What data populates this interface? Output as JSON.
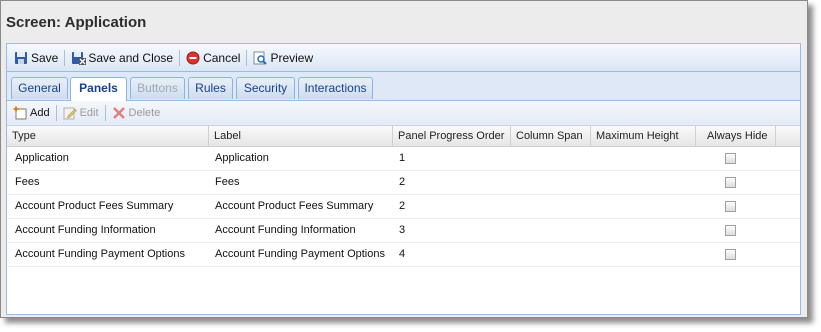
{
  "screen_title": "Screen: Application",
  "toolbar": {
    "save": "Save",
    "save_close": "Save and Close",
    "cancel": "Cancel",
    "preview": "Preview"
  },
  "tabs": [
    "General",
    "Panels",
    "Buttons",
    "Rules",
    "Security",
    "Interactions"
  ],
  "active_tab": "Panels",
  "disabled_tab": "Buttons",
  "actions": {
    "add": "Add",
    "edit": "Edit",
    "delete": "Delete"
  },
  "grid": {
    "columns": [
      "Type",
      "Label",
      "Panel Progress Order",
      "Column Span",
      "Maximum Height",
      "Always Hide"
    ],
    "rows": [
      {
        "type": "Application",
        "label": "Application",
        "order": "1",
        "span": "",
        "max_height": "",
        "always_hide": false
      },
      {
        "type": "Fees",
        "label": "Fees",
        "order": "2",
        "span": "",
        "max_height": "",
        "always_hide": false
      },
      {
        "type": "Account Product Fees Summary",
        "label": "Account Product Fees Summary",
        "order": "2",
        "span": "",
        "max_height": "",
        "always_hide": false
      },
      {
        "type": "Account Funding Information",
        "label": "Account Funding Information",
        "order": "3",
        "span": "",
        "max_height": "",
        "always_hide": false
      },
      {
        "type": "Account Funding Payment Options",
        "label": "Account Funding Payment Options",
        "order": "4",
        "span": "",
        "max_height": "",
        "always_hide": false
      }
    ]
  },
  "colors": {
    "accent_border": "#99bbe8",
    "tab_text": "#15428b"
  }
}
